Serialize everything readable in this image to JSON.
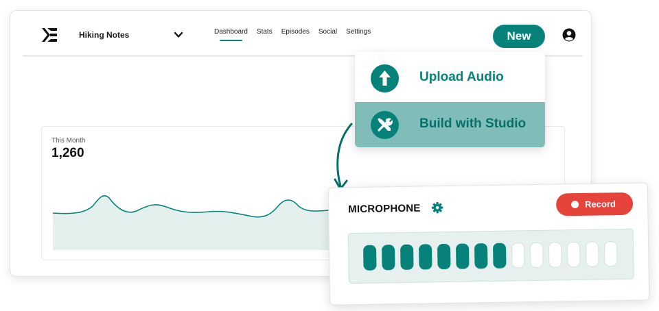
{
  "app": {
    "podcast_name": "Hiking Notes",
    "nav": [
      {
        "label": "Dashboard",
        "active": true
      },
      {
        "label": "Stats",
        "active": false
      },
      {
        "label": "Episodes",
        "active": false
      },
      {
        "label": "Social",
        "active": false
      },
      {
        "label": "Settings",
        "active": false
      }
    ],
    "new_button": "New",
    "icons": {
      "logo": "brand-logo-icon",
      "chevron": "chevron-down-icon",
      "account": "account-icon"
    }
  },
  "stats": {
    "label": "This Month",
    "value": "1,260"
  },
  "new_menu": {
    "items": [
      {
        "label": "Upload Audio",
        "icon": "upload-arrow-icon",
        "highlighted": false
      },
      {
        "label": "Build with Studio",
        "icon": "tools-icon",
        "highlighted": true
      }
    ]
  },
  "microphone": {
    "title": "MICROPHONE",
    "settings_icon": "gear-icon",
    "record_label": "Record",
    "level": {
      "active": 8,
      "total": 14
    }
  },
  "colors": {
    "accent": "#06827b",
    "accent_light": "#80bdb9",
    "record": "#e6443b",
    "chart_fill": "#e4f0ee"
  }
}
